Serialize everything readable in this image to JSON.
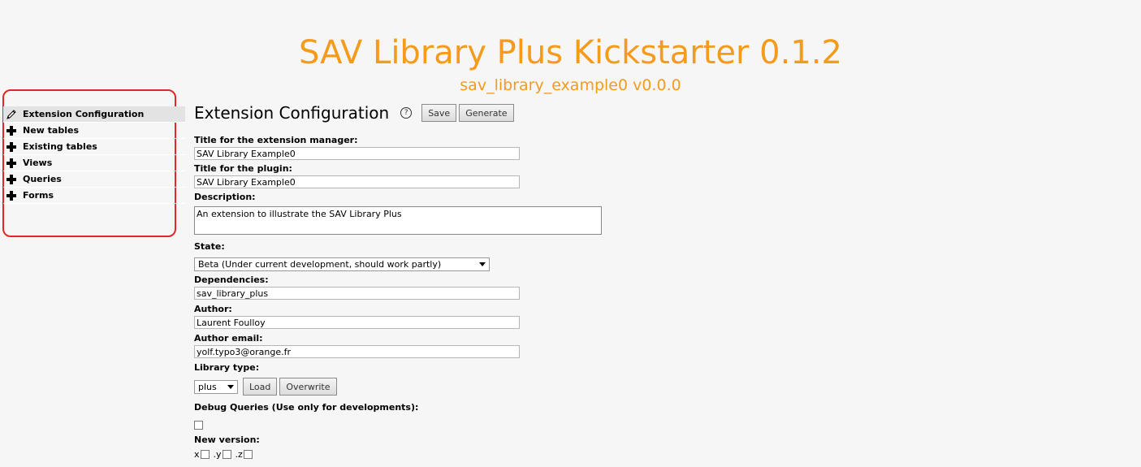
{
  "header": {
    "title": "SAV Library Plus Kickstarter 0.1.2",
    "subtitle": "sav_library_example0 v0.0.0"
  },
  "sidebar": {
    "items": [
      {
        "label": "Extension Configuration",
        "icon": "pencil-icon",
        "active": true
      },
      {
        "label": "New tables",
        "icon": "plus-icon"
      },
      {
        "label": "Existing tables",
        "icon": "plus-icon"
      },
      {
        "label": "Views",
        "icon": "plus-icon"
      },
      {
        "label": "Queries",
        "icon": "plus-icon"
      },
      {
        "label": "Forms",
        "icon": "plus-icon"
      }
    ]
  },
  "main": {
    "heading": "Extension Configuration",
    "help_icon": "?",
    "save_label": "Save",
    "generate_label": "Generate",
    "fields": {
      "title_em_label": "Title for the extension manager:",
      "title_em_value": "SAV Library Example0",
      "title_plugin_label": "Title for the plugin:",
      "title_plugin_value": "SAV Library Example0",
      "description_label": "Description:",
      "description_value": "An extension to illustrate the SAV Library Plus",
      "state_label": "State:",
      "state_value": "Beta (Under current development, should work partly)",
      "dependencies_label": "Dependencies:",
      "dependencies_value": "sav_library_plus",
      "author_label": "Author:",
      "author_value": "Laurent Foulloy",
      "author_email_label": "Author email:",
      "author_email_value": "yolf.typo3@orange.fr",
      "library_type_label": "Library type:",
      "library_type_value": "plus",
      "load_label": "Load",
      "overwrite_label": "Overwrite",
      "debug_label": "Debug Queries (Use only for developments):",
      "new_version_label": "New version:",
      "version_x": "x",
      "version_y": ".y",
      "version_z": ".z"
    }
  },
  "colors": {
    "title": "#f49b1b",
    "highlight_frame": "#e32626"
  }
}
